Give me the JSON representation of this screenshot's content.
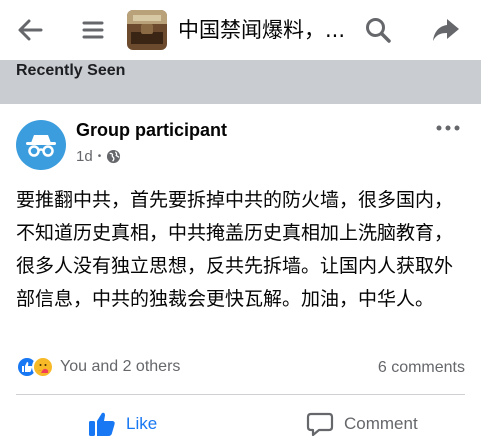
{
  "header": {
    "group_title": "中国禁闻爆料，...",
    "icons": [
      "back-arrow-icon",
      "menu-icon",
      "group-thumbnail",
      "search-icon",
      "share-icon"
    ]
  },
  "recently_seen": {
    "label": "Recently Seen"
  },
  "post": {
    "author": "Group participant",
    "time": "1d",
    "privacy_icon": "globe-icon",
    "body": "要推翻中共，首先要拆掉中共的防火墙，很多国内，不知道历史真相，中共掩盖历史真相加上洗脑教育，很多人没有独立思想，反共先拆墙。让国内人获取外部信息，中共的独裁会更快瓦解。加油，中华人。",
    "reactions_text": "You and 2 others",
    "comments_text": "6 comments",
    "actions": {
      "like": "Like",
      "comment": "Comment"
    }
  },
  "colors": {
    "accent": "#1877f2",
    "recent_bar": "#c9ccd1",
    "avatar": "#3b9ddd"
  }
}
